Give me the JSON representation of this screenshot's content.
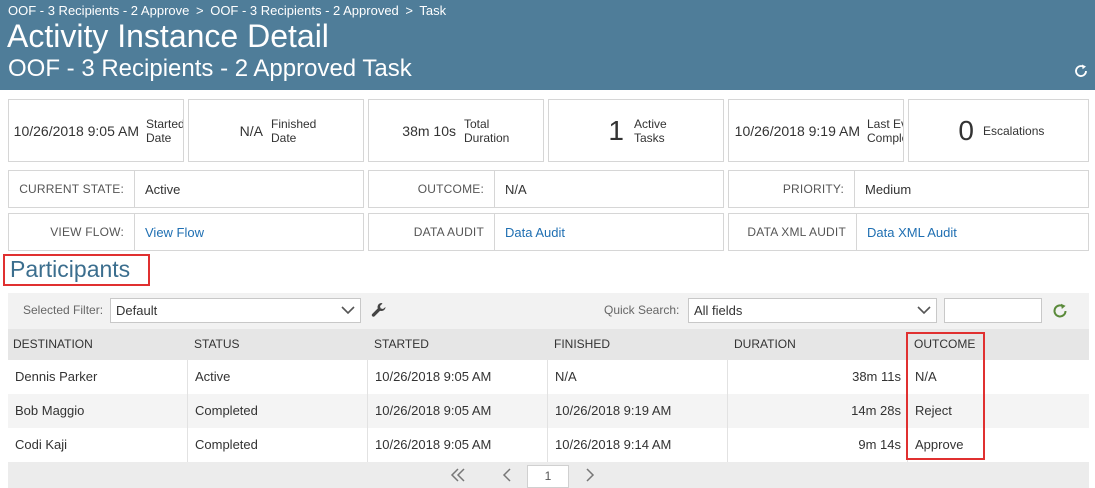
{
  "breadcrumb": [
    {
      "label": "OOF - 3 Recipients - 2 Approve"
    },
    {
      "label": "OOF - 3 Recipients - 2 Approved"
    },
    {
      "label": "Task"
    }
  ],
  "breadcrumb_separator": ">",
  "header": {
    "title": "Activity Instance Detail",
    "subtitle": "OOF - 3 Recipients - 2 Approved Task",
    "refresh_icon": "refresh-icon"
  },
  "stats": [
    {
      "value": "10/26/2018 9:05 AM",
      "label_line1": "Started",
      "label_line2": "Date"
    },
    {
      "value": "N/A",
      "label_line1": "Finished",
      "label_line2": "Date"
    },
    {
      "value": "38m 10s",
      "label_line1": "Total",
      "label_line2": "Duration"
    },
    {
      "value": "1",
      "label_line1": "Active",
      "label_line2": "Tasks"
    },
    {
      "value": "10/26/2018 9:19 AM",
      "label_line1": "Last Ev",
      "label_line2": "Comple"
    },
    {
      "value": "0",
      "label_line1": "Escalations",
      "label_line2": ""
    }
  ],
  "properties": {
    "current_state": {
      "key": "CURRENT STATE:",
      "value": "Active"
    },
    "outcome": {
      "key": "OUTCOME:",
      "value": "N/A"
    },
    "priority": {
      "key": "PRIORITY:",
      "value": "Medium"
    },
    "view_flow": {
      "key": "VIEW FLOW:",
      "value": "View Flow"
    },
    "data_audit": {
      "key": "DATA AUDIT",
      "value": "Data Audit"
    },
    "data_xml_audit": {
      "key": "DATA XML AUDIT",
      "value": "Data XML Audit"
    }
  },
  "participants": {
    "title": "Participants",
    "selected_filter_label": "Selected Filter:",
    "selected_filter_value": "Default",
    "quick_search_label": "Quick Search:",
    "quick_search_scope": "All fields",
    "quick_search_value": "",
    "columns": [
      "DESTINATION",
      "STATUS",
      "STARTED",
      "FINISHED",
      "DURATION",
      "OUTCOME"
    ],
    "rows": [
      {
        "destination": "Dennis Parker",
        "status": "Active",
        "started": "10/26/2018 9:05 AM",
        "finished": "N/A",
        "duration": "38m 11s",
        "outcome": "N/A"
      },
      {
        "destination": "Bob Maggio",
        "status": "Completed",
        "started": "10/26/2018 9:05 AM",
        "finished": "10/26/2018 9:19 AM",
        "duration": "14m 28s",
        "outcome": "Reject"
      },
      {
        "destination": "Codi Kaji",
        "status": "Completed",
        "started": "10/26/2018 9:05 AM",
        "finished": "10/26/2018 9:14 AM",
        "duration": "9m 14s",
        "outcome": "Approve"
      }
    ],
    "pager": {
      "page": "1"
    }
  },
  "colors": {
    "header_bg": "#4f7d99",
    "link": "#1f6fb2",
    "highlight": "#e03030",
    "refresh_green": "#5a8a3a"
  }
}
